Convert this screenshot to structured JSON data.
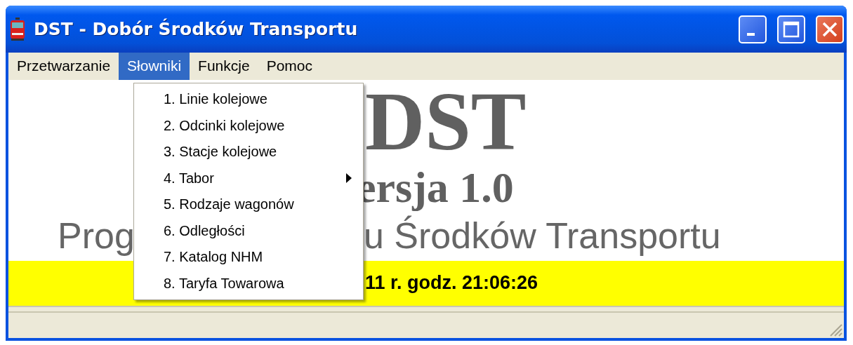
{
  "window": {
    "title": "DST - Dobór Środków Transportu"
  },
  "menu_bar": [
    {
      "label": "Przetwarzanie",
      "selected": false
    },
    {
      "label": "Słowniki",
      "selected": true
    },
    {
      "label": "Funkcje",
      "selected": false
    },
    {
      "label": "Pomoc",
      "selected": false
    }
  ],
  "dropdown": [
    {
      "label": "1. Linie kolejowe",
      "submenu": false
    },
    {
      "label": "2. Odcinki kolejowe",
      "submenu": false
    },
    {
      "label": "3. Stacje kolejowe",
      "submenu": false
    },
    {
      "label": "4. Tabor",
      "submenu": true
    },
    {
      "label": "5. Rodzaje wagonów",
      "submenu": false
    },
    {
      "label": "6. Odległości",
      "submenu": false
    },
    {
      "label": "7. Katalog NHM",
      "submenu": false
    },
    {
      "label": "8. Taryfa Towarowa",
      "submenu": false
    }
  ],
  "splash": {
    "logo": "DST",
    "version": "ersja 1.0",
    "subtitle_left": "Prog",
    "subtitle_right": "u Środków Transportu"
  },
  "date_bar": {
    "text": "11 r.  godz. 21:06:26"
  }
}
